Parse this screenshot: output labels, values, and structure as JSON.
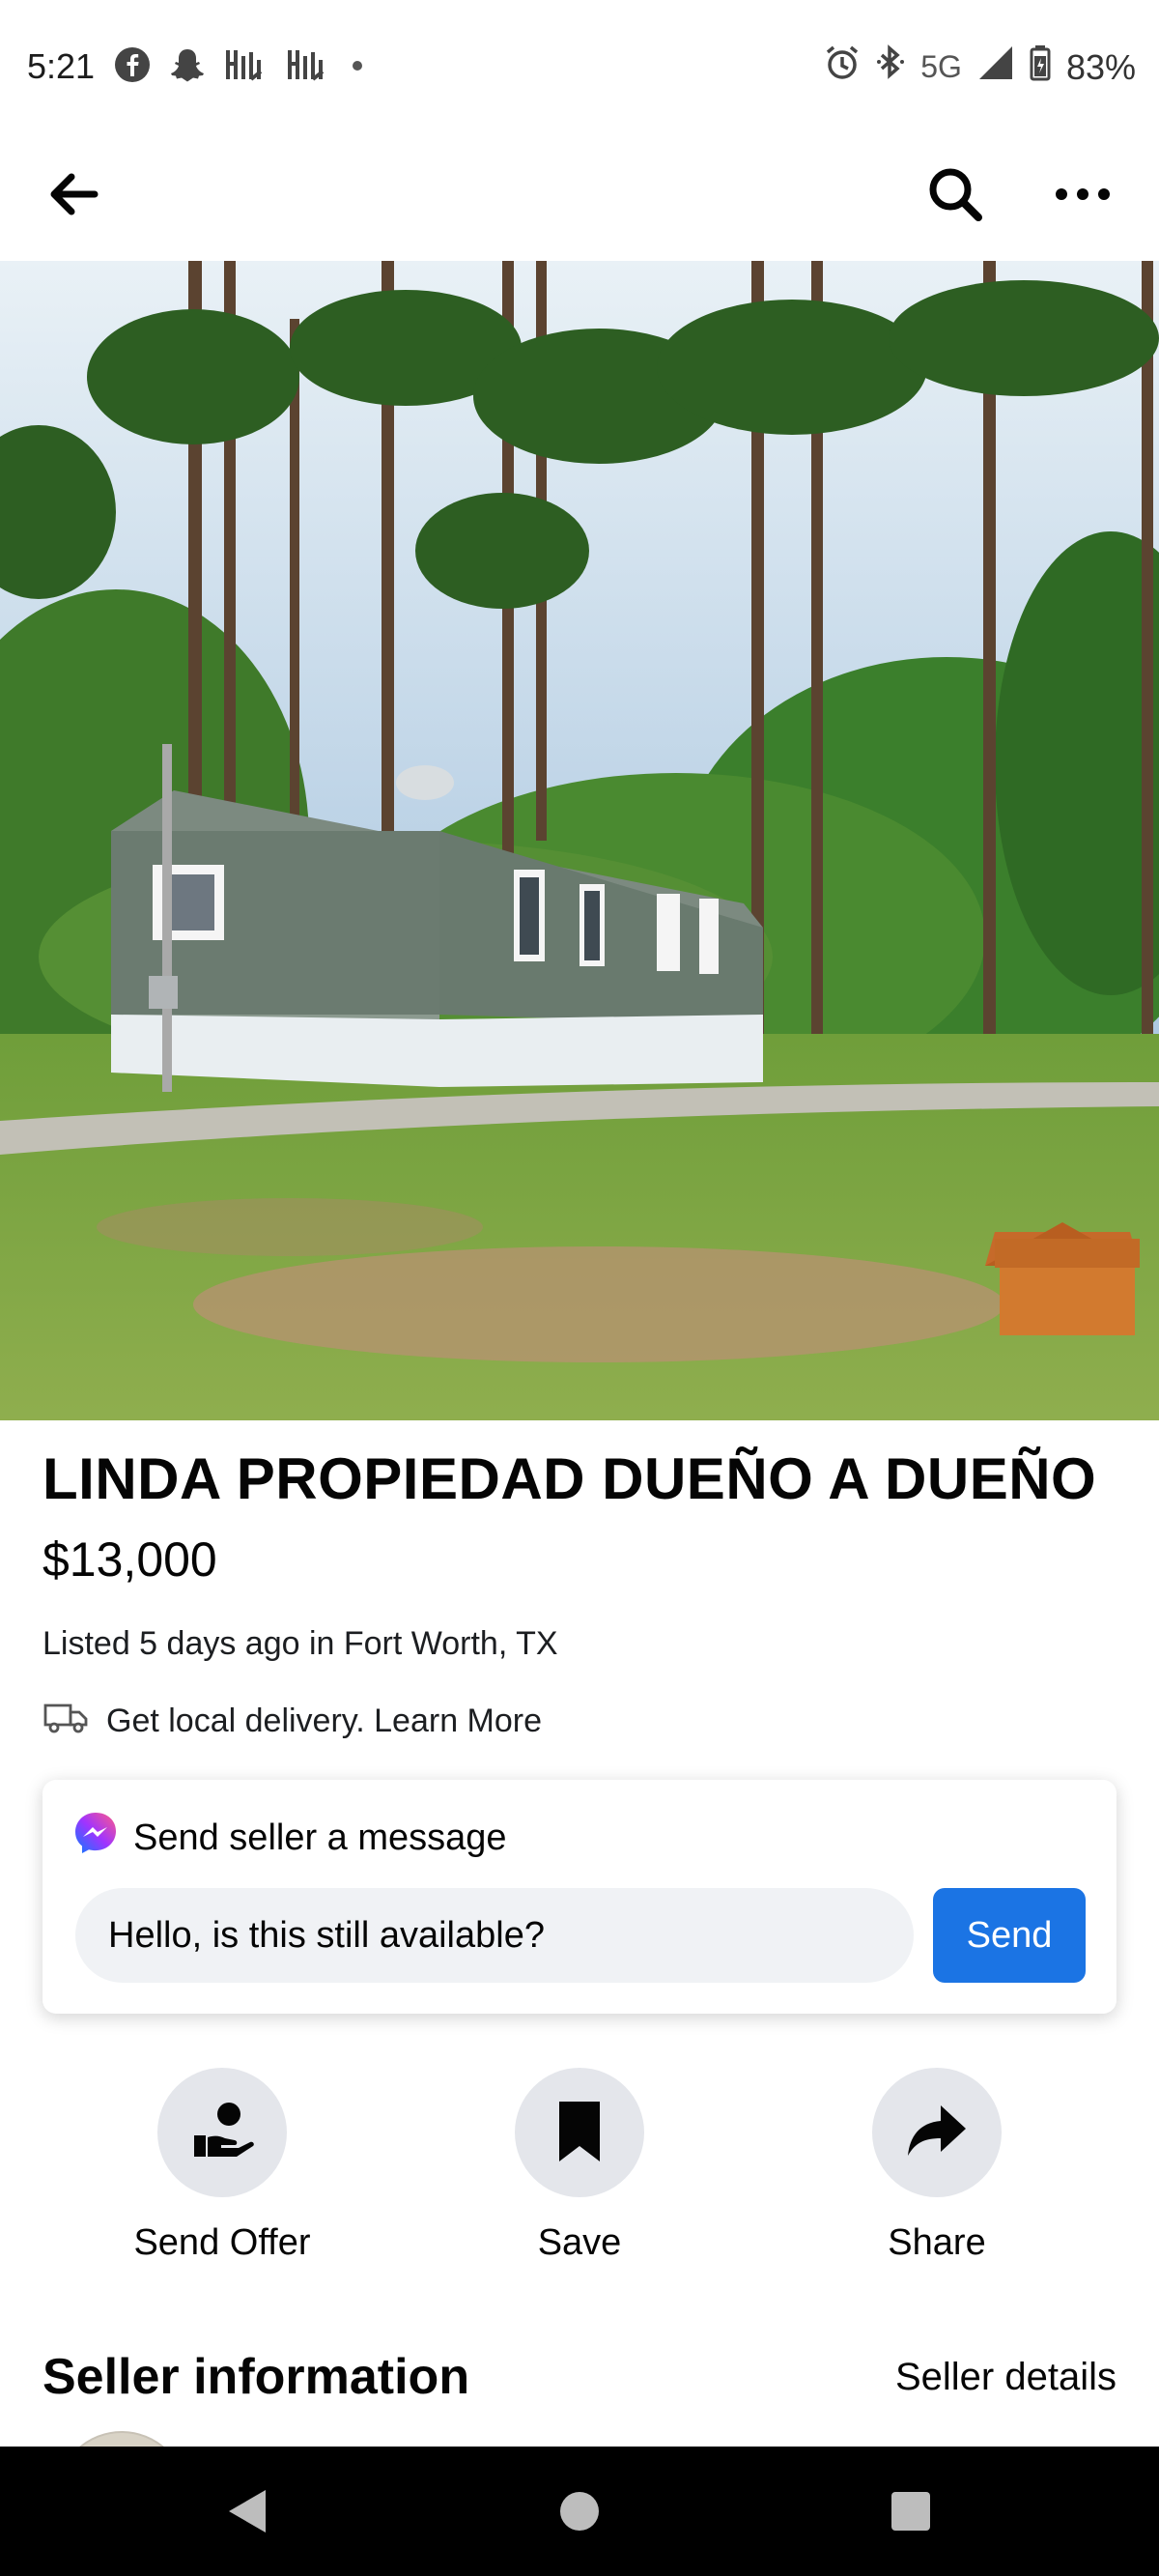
{
  "status_bar": {
    "time": "5:21",
    "network": "5G",
    "battery": "83%",
    "left_icons": [
      "facebook-icon",
      "snapchat-icon",
      "signal-app-icon",
      "signal-app-icon",
      "dot-icon"
    ],
    "right_icons": [
      "alarm-icon",
      "bluetooth-icon",
      "5g-label",
      "cell-signal-icon",
      "battery-icon"
    ]
  },
  "app_bar": {
    "icons": [
      "back-arrow-icon",
      "search-icon",
      "more-options-icon"
    ]
  },
  "listing": {
    "title": "LINDA PROPIEDAD DUEÑO A DUEÑO",
    "price": "$13,000",
    "listed": "Listed 5 days ago in Fort Worth, TX",
    "delivery": "Get local delivery. Learn More"
  },
  "message": {
    "header": "Send seller a message",
    "input_value": "Hello, is this still available?",
    "send_label": "Send"
  },
  "actions": [
    {
      "label": "Send Offer",
      "icon": "send-offer-icon"
    },
    {
      "label": "Save",
      "icon": "bookmark-icon"
    },
    {
      "label": "Share",
      "icon": "share-arrow-icon"
    }
  ],
  "seller": {
    "title": "Seller information",
    "details_link": "Seller details"
  },
  "colors": {
    "accent": "#1b74e4",
    "action_bg": "#e4e6eb",
    "input_bg": "#f0f2f5",
    "nav_bg": "#000000"
  }
}
